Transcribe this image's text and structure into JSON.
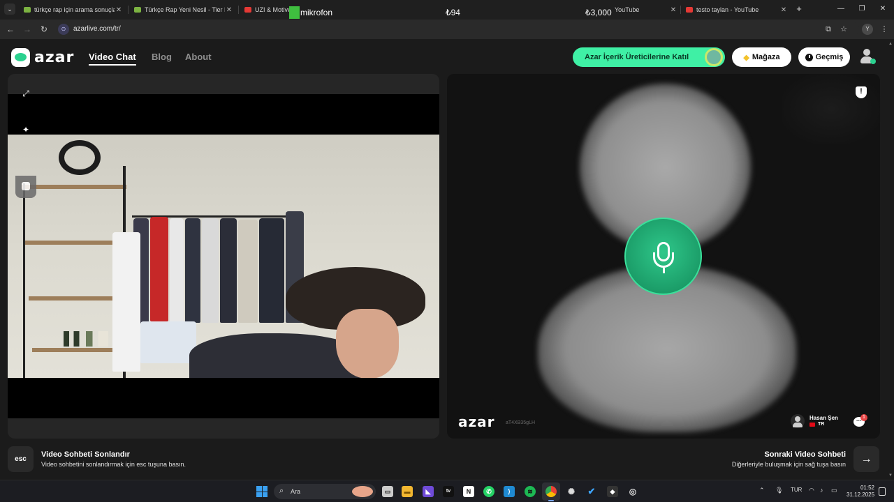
{
  "browser": {
    "tabs": [
      {
        "title": "türkçe rap için arama sonuçları",
        "favicon_color": "#7cb342"
      },
      {
        "title": "Türkçe Rap Yeni Nesil - Tier List",
        "favicon_color": "#7cb342"
      },
      {
        "title": "UZI & Motive",
        "favicon_color": "#e53935"
      },
      {
        "title": "YouTube",
        "favicon_color": "#e53935"
      },
      {
        "title": "testo taylan - YouTube",
        "favicon_color": "#e53935"
      }
    ],
    "overlay": {
      "label": "mikrofon",
      "price_1": "₺94",
      "price_2": "₺3,000"
    },
    "url": "azarlive.com/tr/",
    "profile_initial": "Y"
  },
  "header": {
    "logo_text": "azar",
    "nav": [
      "Video Chat",
      "Blog",
      "About"
    ],
    "creator_cta": "Azar İçerik Üreticilerine Katıl",
    "store_label": "Mağaza",
    "history_label": "Geçmiş"
  },
  "right_panel": {
    "logo_text": "azar",
    "session_id": "aT4XB35gLH",
    "peer_name": "Hasan Şen",
    "peer_country": "TR",
    "chat_badge": "1"
  },
  "bottom": {
    "esc_key": "esc",
    "end_title": "Video Sohbeti Sonlandır",
    "end_sub": "Video sohbetini sonlandırmak için esc tuşuna basın.",
    "next_title": "Sonraki Video Sohbeti",
    "next_sub": "Diğerleriyle buluşmak için sağ tuşa basın",
    "next_key": "→"
  },
  "taskbar": {
    "search_placeholder": "Ara",
    "language": "TUR",
    "time": "01:52",
    "date": "31.12.2025"
  },
  "colors": {
    "accent_green": "#3ff0a5",
    "mic_green": "#1a9a66",
    "badge_red": "#e84545"
  }
}
